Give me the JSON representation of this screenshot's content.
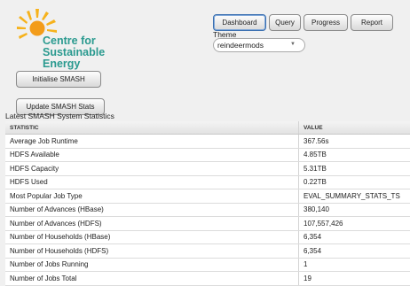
{
  "logo": {
    "lines": [
      "Centre for",
      "Sustainable",
      "Energy"
    ],
    "sun_color": "#f39c1a",
    "text_color": "#2a9a8f"
  },
  "buttons": {
    "initialise": "Initialise SMASH",
    "update": "Update SMASH Stats"
  },
  "nav": {
    "tabs": [
      "Dashboard",
      "Query",
      "Progress",
      "Report"
    ],
    "active": "Dashboard"
  },
  "theme": {
    "label": "Theme",
    "value": "reindeermods"
  },
  "stats": {
    "title": "Latest SMASH System Statistics",
    "headers": [
      "STATISTIC",
      "VALUE"
    ],
    "rows": [
      [
        "Average Job Runtime",
        "367.56s"
      ],
      [
        "HDFS Available",
        "4.85TB"
      ],
      [
        "HDFS Capacity",
        "5.31TB"
      ],
      [
        "HDFS Used",
        "0.22TB"
      ],
      [
        "Most Popular Job Type",
        "EVAL_SUMMARY_STATS_TS"
      ],
      [
        "Number of Advances (HBase)",
        "380,140"
      ],
      [
        "Number of Advances (HDFS)",
        "107,557,426"
      ],
      [
        "Number of Households (HBase)",
        "6,354"
      ],
      [
        "Number of Households (HDFS)",
        "6,354"
      ],
      [
        "Number of Jobs Running",
        "1"
      ],
      [
        "Number of Jobs Total",
        "19"
      ]
    ]
  }
}
